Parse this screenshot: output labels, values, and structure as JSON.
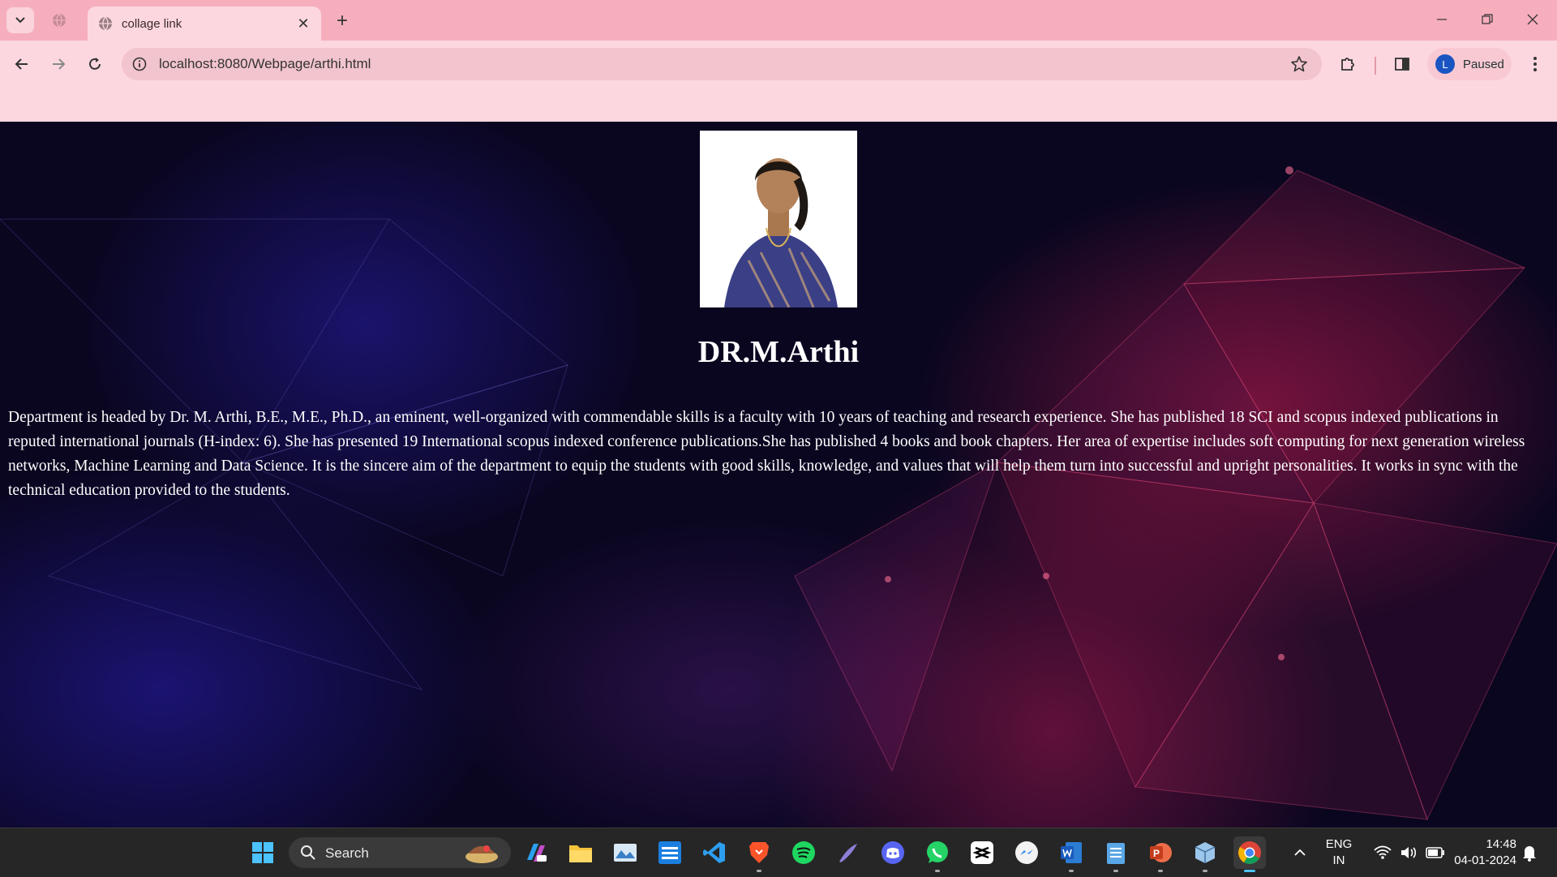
{
  "browser": {
    "tab_title": "collage link",
    "url": "localhost:8080/Webpage/arthi.html",
    "profile_initial": "L",
    "profile_status": "Paused"
  },
  "page": {
    "heading": "DR.M.Arthi",
    "bio": "Department is headed by Dr. M. Arthi, B.E., M.E., Ph.D., an eminent, well-organized with commendable skills is a faculty with 10 years of teaching and research experience. She has published 18 SCI and scopus indexed publications in reputed international journals (H-index: 6). She has presented 19 International scopus indexed conference publications.She has published 4 books and book chapters. Her area of expertise includes soft computing for next generation wireless networks, Machine Learning and Data Science. It is the sincere aim of the department to equip the students with good skills, knowledge, and values that will help them turn into successful and upright personalities. It works in sync with the technical education provided to the students."
  },
  "taskbar": {
    "search_label": "Search",
    "language": "ENG",
    "region": "IN",
    "time": "14:48",
    "date": "04-01-2024"
  },
  "colors": {
    "tabstrip": "#f6aebd",
    "toolbar": "#fdd7df",
    "taskbar": "#262626"
  }
}
